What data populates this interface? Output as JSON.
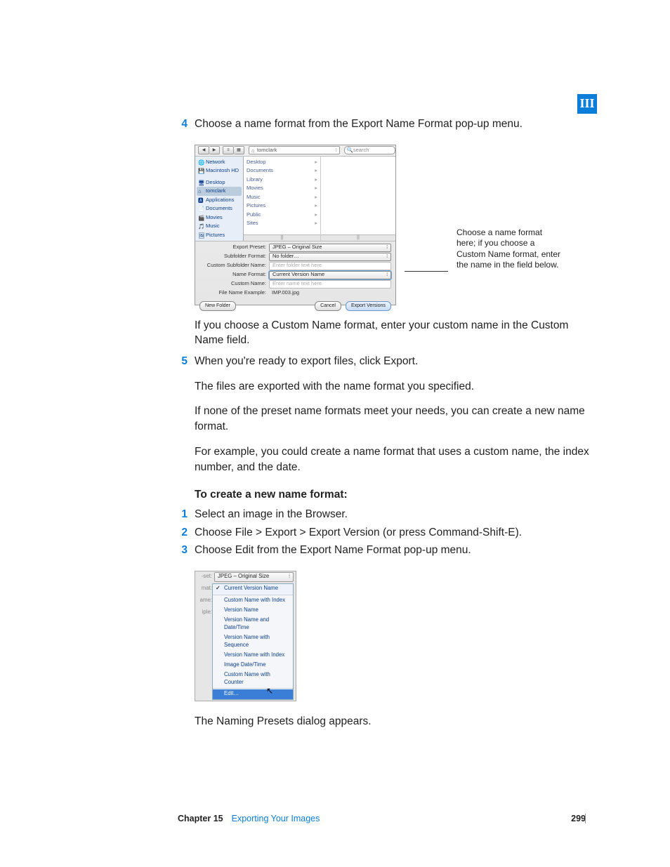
{
  "tab": "III",
  "steps_a": [
    {
      "n": "4",
      "text": "Choose a name format from the Export Name Format pop-up menu."
    }
  ],
  "fig1": {
    "toolbar": {
      "back": "◀",
      "fwd": "▶",
      "v1": "≡",
      "v2": "▦",
      "path_icon": "⌂",
      "path": "tomclark",
      "search_icon": "🔍",
      "search_ph": "search"
    },
    "sidebar": [
      {
        "icon": "🌐",
        "label": "Network"
      },
      {
        "icon": "💾",
        "label": "Macintosh HD"
      },
      {
        "icon": "🖥",
        "label": "Desktop"
      },
      {
        "icon": "⌂",
        "label": "tomclark",
        "sel": true
      },
      {
        "icon": "🅰",
        "label": "Applications"
      },
      {
        "icon": "📄",
        "label": "Documents"
      },
      {
        "icon": "🎬",
        "label": "Movies"
      },
      {
        "icon": "🎵",
        "label": "Music"
      },
      {
        "icon": "🖼",
        "label": "Pictures"
      }
    ],
    "col1": [
      "Desktop",
      "Documents",
      "Library",
      "Movies",
      "Music",
      "Pictures",
      "Public",
      "Sites"
    ],
    "scroll_thumb": "||",
    "form": {
      "l1": "Export Preset:",
      "v1": "JPEG – Original Size",
      "l2": "Subfolder Format:",
      "v2": "No folder…",
      "l3": "Custom Subfolder Name:",
      "p3": "Enter folder text here",
      "l4": "Name Format:",
      "v4": "Current Version Name",
      "l5": "Custom Name:",
      "p5": "Enter name text here",
      "l6": "File Name Example:",
      "v6": "IMP.003.jpg",
      "stepper": "⦙"
    },
    "buttons": {
      "newfolder": "New Folder",
      "cancel": "Cancel",
      "export": "Export Versions"
    },
    "callout": "Choose a name format here; if you choose a Custom Name format, enter the name in the field below."
  },
  "paras1": [
    "If you choose a Custom Name format, enter your custom name in the Custom Name field."
  ],
  "steps_b": [
    {
      "n": "5",
      "text": "When you're ready to export files, click Export."
    }
  ],
  "paras2": [
    "The files are exported with the name format you specified.",
    "If none of the preset name formats meet your needs, you can create a new name format.",
    "For example, you could create a name format that uses a custom name, the index number, and the date."
  ],
  "heading": "To create a new name format:",
  "steps_c": [
    {
      "n": "1",
      "text": "Select an image in the Browser."
    },
    {
      "n": "2",
      "text": "Choose File > Export > Export Version (or press Command-Shift-E)."
    },
    {
      "n": "3",
      "text": "Choose Edit from the Export Name Format pop-up menu."
    }
  ],
  "fig2": {
    "rows": [
      {
        "label": "-set:",
        "value": "JPEG – Original Size"
      },
      {
        "label": "mat:"
      },
      {
        "label": "ame:"
      },
      {
        "label": "iple:"
      }
    ],
    "stepper": "⦙",
    "menu": [
      {
        "text": "Current Version Name",
        "check": true,
        "sel": true
      },
      {
        "sep": true
      },
      {
        "text": "Custom Name with Index"
      },
      {
        "text": "Version Name"
      },
      {
        "text": "Version Name and Date/Time"
      },
      {
        "text": "Version Name with Sequence"
      },
      {
        "text": "Version Name with Index"
      },
      {
        "text": "Image Date/Time"
      },
      {
        "text": "Custom Name with Counter"
      },
      {
        "sep": true
      },
      {
        "text": "Edit…",
        "hl": true
      }
    ],
    "cursor": "↖"
  },
  "para3": "The Naming Presets dialog appears.",
  "footer": {
    "chapter": "Chapter 15",
    "title": "Exporting Your Images",
    "page": "299"
  }
}
